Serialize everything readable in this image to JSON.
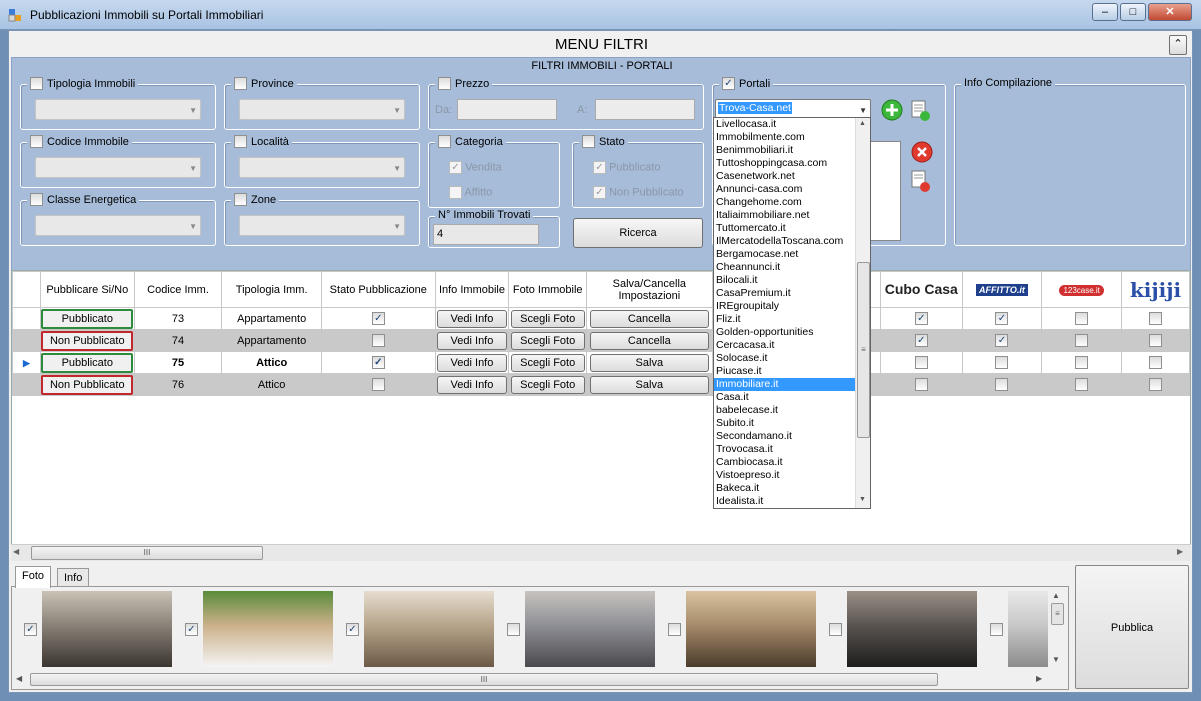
{
  "window": {
    "title": "Pubblicazioni Immobili su Portali Immobiliari",
    "min": "–",
    "max": "□",
    "close": "✕"
  },
  "menu": {
    "title": "MENU FILTRI",
    "panel_title": "FILTRI IMMOBILI - PORTALI",
    "collapse_glyph": "⌃"
  },
  "filters": {
    "tipologia": "Tipologia Immobili",
    "province": "Province",
    "prezzo": "Prezzo",
    "da": "Da:",
    "a": "A:",
    "portali": "Portali",
    "info_compilazione": "Info Compilazione",
    "codice": "Codice Immobile",
    "localita": "Località",
    "categoria": "Categoria",
    "vendita": "Vendita",
    "affitto": "Affitto",
    "stato": "Stato",
    "pubblicato": "Pubblicato",
    "non_pubblicato": "Non Pubblicato",
    "classe": "Classe Energetica",
    "zone": "Zone",
    "trovati_label": "N° Immobili Trovati",
    "trovati_value": "4",
    "ricerca": "Ricerca",
    "portale_selected": "Trova-Casa.net"
  },
  "grid": {
    "headers": [
      "Pubblicare Si/No",
      "Codice Imm.",
      "Tipologia Imm.",
      "Stato Pubblicazione",
      "Info Immobile",
      "Foto Immobile",
      "Salva/Cancella Impostazioni"
    ],
    "portal_headers": [
      "Cubo Casa",
      "AFFITTO.it",
      "123case.it",
      "kijiji"
    ],
    "rows": [
      {
        "pub": "Pubblicato",
        "pub_color": "#2e8b3e",
        "codice": "73",
        "tipo": "Appartamento",
        "stato": "✓",
        "info": "Vedi Info",
        "foto": "Scegli Foto",
        "salva": "Cancella",
        "p": [
          "✓",
          "✓",
          "",
          ""
        ]
      },
      {
        "pub": "Non Pubblicato",
        "pub_color": "#c0282c",
        "codice": "74",
        "tipo": "Appartamento",
        "stato": "",
        "info": "Vedi Info",
        "foto": "Scegli Foto",
        "salva": "Cancella",
        "p": [
          "✓",
          "✓",
          "",
          ""
        ]
      },
      {
        "pub": "Pubblicato",
        "pub_color": "#2e8b3e",
        "codice": "75",
        "tipo": "Attico",
        "stato": "✓",
        "info": "Vedi Info",
        "foto": "Scegli Foto",
        "salva": "Salva",
        "p": [
          "",
          "",
          "",
          ""
        ]
      },
      {
        "pub": "Non Pubblicato",
        "pub_color": "#c0282c",
        "codice": "76",
        "tipo": "Attico",
        "stato": "",
        "info": "Vedi Info",
        "foto": "Scegli Foto",
        "salva": "Salva",
        "p": [
          "",
          "",
          "",
          ""
        ]
      }
    ],
    "scroll_grip": "III"
  },
  "dropdown_items": [
    "Livellocasa.it",
    "Immobilmente.com",
    "Benimmobiliari.it",
    "Tuttoshoppingcasa.com",
    "Casenetwork.net",
    "Annunci-casa.com",
    "Changehome.com",
    "Italiaimmobiliare.net",
    "Tuttomercato.it",
    "IlMercatodellaToscana.com",
    "Bergamocase.net",
    "Cheannunci.it",
    "Bilocali.it",
    "CasaPremium.it",
    "IREgroupitaly",
    "Fliz.it",
    "Golden-opportunities",
    "Cercacasa.it",
    "Solocase.it",
    "Piucase.it",
    "Immobiliare.it",
    "Casa.it",
    "babelecase.it",
    "Subito.it",
    "Secondamano.it",
    "Trovocasa.it",
    "Cambiocasa.it",
    "Vistoepreso.it",
    "Bakeca.it",
    "Idealista.it"
  ],
  "dropdown_selected_index": 20,
  "tabs": [
    "Foto",
    "Info"
  ],
  "photos": [
    {
      "checked": "✓"
    },
    {
      "checked": "✓"
    },
    {
      "checked": "✓"
    },
    {
      "checked": ""
    },
    {
      "checked": ""
    },
    {
      "checked": ""
    },
    {
      "checked": ""
    }
  ],
  "pubblica": "Pubblica",
  "photo_scroll_grip": "III"
}
